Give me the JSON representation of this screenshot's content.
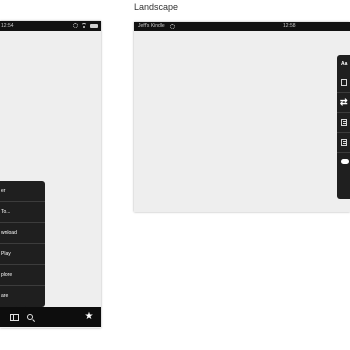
{
  "landscape": {
    "title": "Landscape",
    "status_bar": {
      "device_name": "Jeff's Kindle",
      "time": "12:58"
    },
    "panel": {
      "heading": "Aa"
    }
  },
  "portrait": {
    "status_bar": {
      "time": "12:54"
    },
    "menu": {
      "items": [
        "er",
        "To...",
        "wnload",
        "Play",
        "plore",
        "are"
      ]
    },
    "toolbar": {
      "icons": [
        "book-icon",
        "search-icon",
        "star-icon"
      ]
    }
  }
}
